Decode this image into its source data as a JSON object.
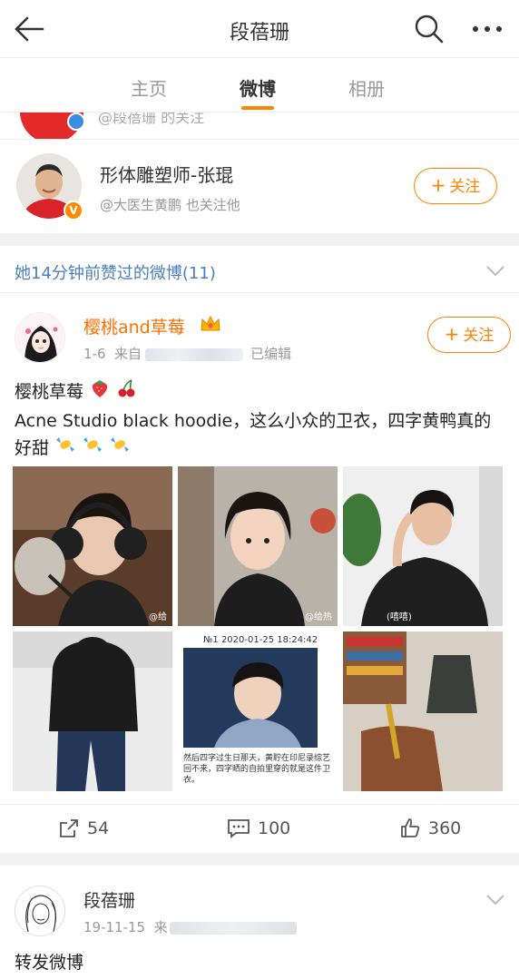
{
  "header": {
    "title": "段蓓珊",
    "back_icon": "back-arrow-icon",
    "search_icon": "search-icon",
    "more_icon": "more-icon"
  },
  "tabs": [
    {
      "label": "主页"
    },
    {
      "label": "微博"
    },
    {
      "label": "相册"
    }
  ],
  "active_tab": "微博",
  "accent_color": "#ff8200",
  "link_color": "#4a7fbf",
  "cutoff_row": {
    "text": "@段蓓珊 的关注"
  },
  "recommendation": {
    "name": "形体雕塑师-张琨",
    "subtitle": "@大医生黄鹏 也关注他",
    "follow_label": "关注"
  },
  "liked_section": {
    "label": "她14分钟前赞过的微博(11)"
  },
  "post": {
    "author": "樱桃and草莓",
    "date": "1-6",
    "source_prefix": "来自",
    "edited": "已编辑",
    "follow_label": "关注",
    "text_line1": "樱桃草莓",
    "text_line2": "Acne Studio black hoodie，这么小众的卫衣，四字黄鸭真的好甜",
    "image_captions": {
      "img1": "@给",
      "img2": "@给热",
      "img3": "(嘻嘻)",
      "img5_header": "№1  2020-01-25 18:24:42",
      "img5_text": "然后四字过生日那天，黄聍在印尼录综艺回不来，四字晒的自拍里穿的就是这件卫衣。"
    },
    "reposts": "54",
    "comments": "100",
    "likes": "360"
  },
  "post2": {
    "author": "段蓓珊",
    "date": "19-11-15",
    "source_prefix": "来",
    "text": "转发微博"
  }
}
